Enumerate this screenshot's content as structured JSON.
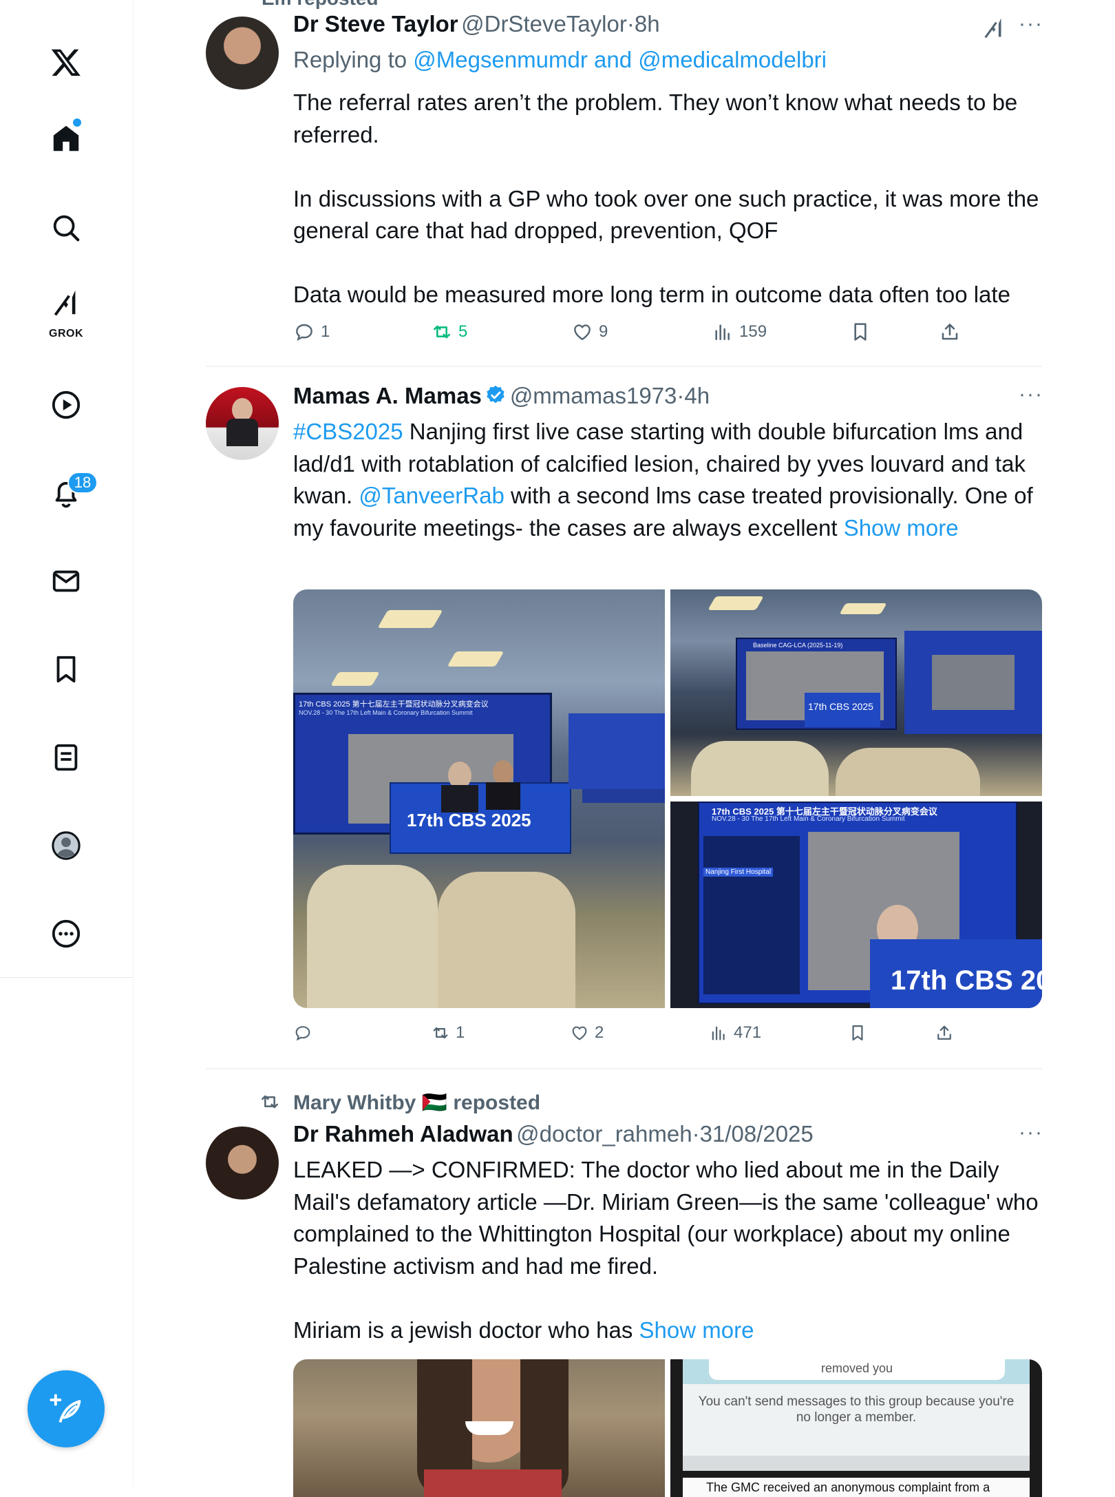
{
  "sidebar": {
    "logo": "x-logo",
    "grok_label": "GROK",
    "notifications_count": "18",
    "items": [
      "home-icon",
      "search-icon",
      "grok-icon",
      "video-icon",
      "bell-icon",
      "mail-icon",
      "bookmark-icon",
      "lists-icon",
      "profile-icon",
      "more-icon"
    ]
  },
  "partial_top": {
    "text": "Em reposted"
  },
  "tweet1": {
    "name": "Dr Steve Taylor",
    "handle": "@DrSteveTaylor",
    "sep": "·",
    "time": "8h",
    "replying_prefix": "Replying to ",
    "replying_to": "@Megsenmumdr and @medicalmodelbri",
    "text": "The referral rates aren’t the problem. They won’t know what needs to be referred.\n\nIn discussions with a GP who took over one such practice, it was more the general care that had dropped, prevention, QOF\n\nData would be measured more long term in outcome data often too late",
    "replies": "1",
    "reposts": "5",
    "likes": "9",
    "views": "159"
  },
  "tweet2": {
    "name": "Mamas A. Mamas",
    "handle": "@mmamas1973",
    "sep": "·",
    "time": "4h",
    "hashtag": "#CBS2025",
    "text_a": " Nanjing first live case starting with double bifurcation lms and lad/d1 with rotablation of calcified lesion, chaired by yves louvard and tak kwan. ",
    "mention": "@TanveerRab",
    "text_b": " with a second lms case treated provisionally. One of my favourite meetings- the cases are always excellent ",
    "show_more": "Show more",
    "replies": "",
    "reposts": "1",
    "likes": "2",
    "views": "471",
    "media": {
      "banner_main": "17th CBS 2025",
      "banner_small": "17th CBS 2025",
      "banner_bottom": "17th CBS 20",
      "screen_title": "17th CBS 2025 第十七届左主干暨冠状动脉分叉病变会议",
      "screen_sub": "NOV.28 - 30 The 17th Left Main & Coronary Bifurcation Summit",
      "hospital": "Nanjing First Hospital",
      "small_screen": "Baseline CAG-LCA (2025-11-19)"
    }
  },
  "tweet3": {
    "repost_by": "Mary Whitby 🇵🇸 reposted",
    "name": "Dr Rahmeh Aladwan",
    "handle": "@doctor_rahmeh",
    "sep": "·",
    "time": "31/08/2025",
    "text": "LEAKED —> CONFIRMED: The doctor who lied about me in the Daily Mail's defamatory article —Dr. Miriam Green—is the same 'colleague' who complained to the Whittington Hospital (our workplace) about my online Palestine activism and had me fired.\n\nMiriam is a jewish doctor who has ",
    "show_more": "Show more",
    "media": {
      "removed": "removed you",
      "cant_send": "You can't send messages to this group because you're no longer a member.",
      "gmc": "The GMC received an anonymous complaint from a"
    }
  }
}
